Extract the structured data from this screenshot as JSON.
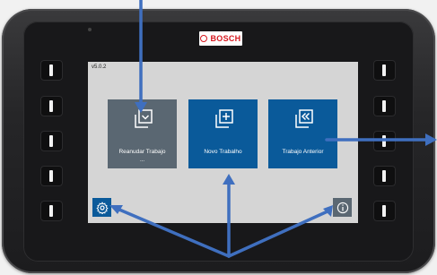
{
  "device": {
    "brand": "BOSCH"
  },
  "screen": {
    "version": "v5.0.2",
    "tiles": [
      {
        "label": "Reanudar Trabajo",
        "sub": "...",
        "icon": "resume-job-icon",
        "color": "#5a6772"
      },
      {
        "label": "Novo Trabalho",
        "sub": "",
        "icon": "new-job-icon",
        "color": "#0a5a9a"
      },
      {
        "label": "Trabajo Anterior",
        "sub": "",
        "icon": "previous-job-icon",
        "color": "#0a5a9a"
      }
    ],
    "settings_icon": "gear-icon",
    "info_icon": "info-icon"
  },
  "annotations": {
    "arrow_color": "#3f6fbf"
  }
}
